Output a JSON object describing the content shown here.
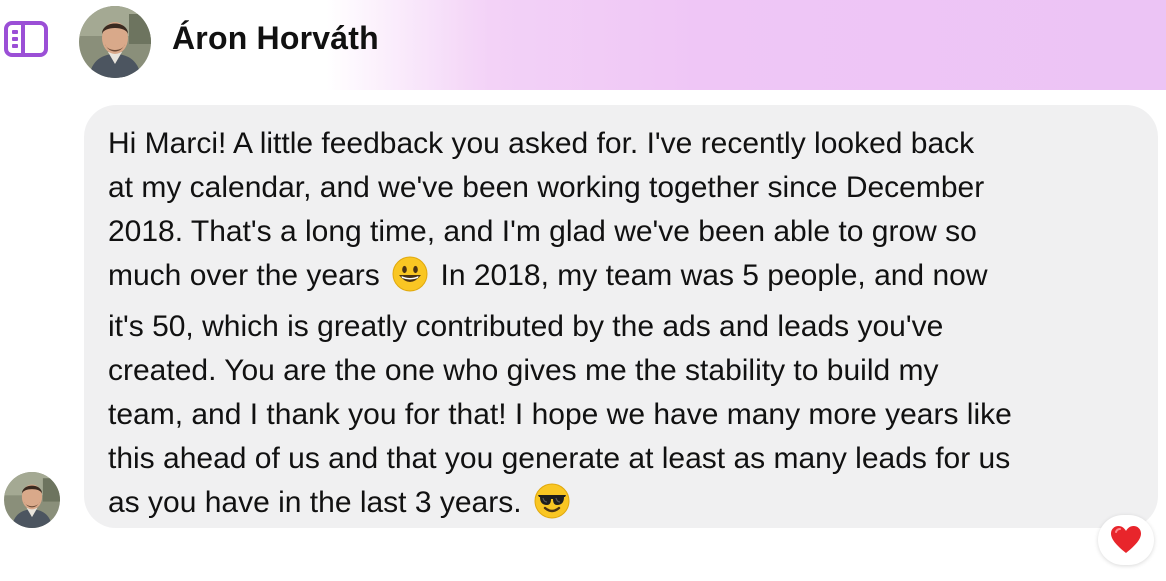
{
  "header": {
    "contact_name": "Áron Horváth",
    "icons": {
      "sidebar_toggle": "sidebar-toggle-icon",
      "avatar": "profile-avatar"
    },
    "accent_color": "#9b4fd6",
    "gradient_color": "#ecc4f5"
  },
  "message": {
    "lines": [
      "Hi Marci! A little feedback you asked for. I've recently looked back",
      "at my calendar, and we've been working together since December",
      "2018. That's a long time, and I'm glad we've been able to grow so",
      "much over the years",
      "In 2018, my team was 5 people, and now",
      "it's 50, which is greatly contributed by the ads and leads you've",
      "created. You are the one who gives me the stability to build my",
      "team, and I thank you for that! I hope we have many more years like",
      "this ahead of us and that you generate at least as many leads for us",
      "as you have in the last 3 years."
    ],
    "emojis": [
      "smiling-face-emoji",
      "sunglasses-face-emoji"
    ],
    "bubble_color": "#f0f0f1"
  },
  "reaction": {
    "icon": "red-heart-icon",
    "color": "#e8252b"
  }
}
